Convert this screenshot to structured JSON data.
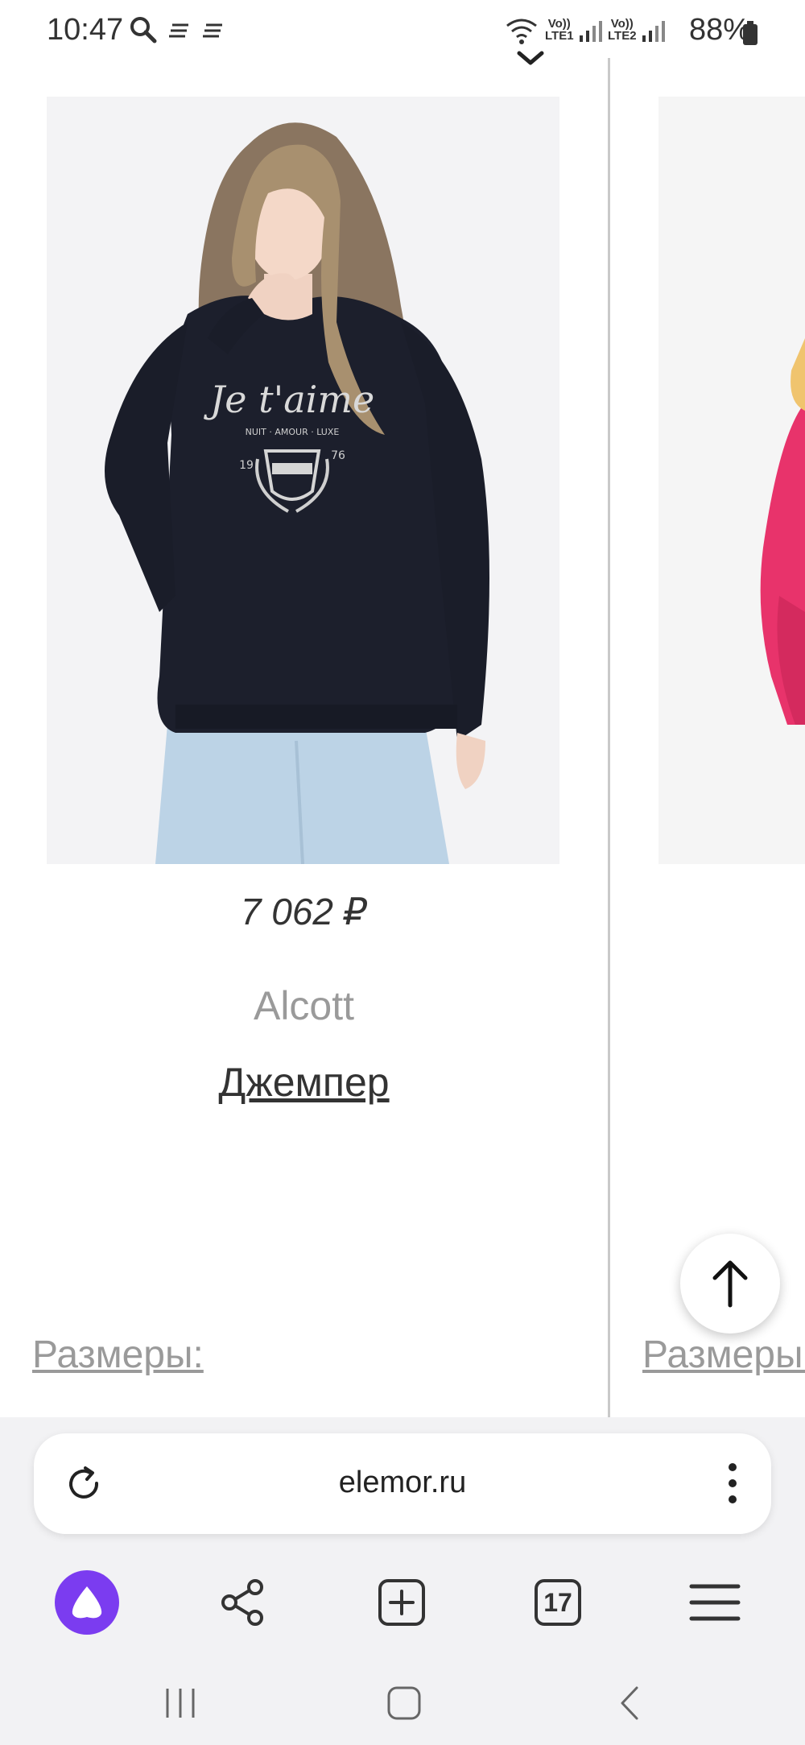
{
  "status_bar": {
    "time": "10:47",
    "battery": "88%",
    "sim1": "Vo))\nLTE1",
    "sim2": "Vo))\nLTE2"
  },
  "product": {
    "price": "7 062 ₽",
    "brand": "Alcott",
    "name": "Джемпер",
    "sizes_label": "Размеры:",
    "print_text": "Je t'aime",
    "print_subtext": "NUIT · AMOUR · LUXE",
    "print_year_left": "19",
    "print_year_right": "76"
  },
  "second_card": {
    "sizes_label": "Размеры:"
  },
  "browser": {
    "url": "elemor.ru",
    "tab_count": "17"
  },
  "colors": {
    "assistant": "#7b3cf0",
    "sweater": "#1c1f2c",
    "pink_sweater": "#e8336b"
  }
}
